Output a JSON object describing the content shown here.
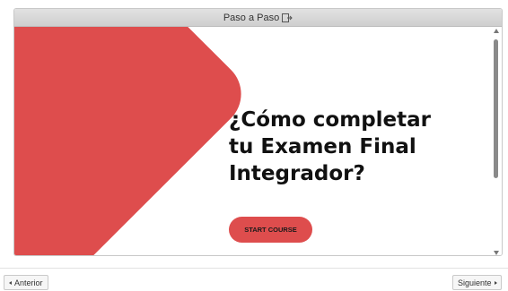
{
  "window": {
    "title": "Paso a Paso",
    "popout_icon": "popout-icon"
  },
  "slide": {
    "headline_lines": [
      "¿Cómo completar",
      "tu Examen Final",
      "Integrador?"
    ],
    "start_button_label": "START COURSE",
    "accent_color": "#de4d4d"
  },
  "navigation": {
    "prev_label": "Anterior",
    "next_label": "Siguiente",
    "prev_icon": "triangle-left-icon",
    "next_icon": "triangle-right-icon"
  }
}
